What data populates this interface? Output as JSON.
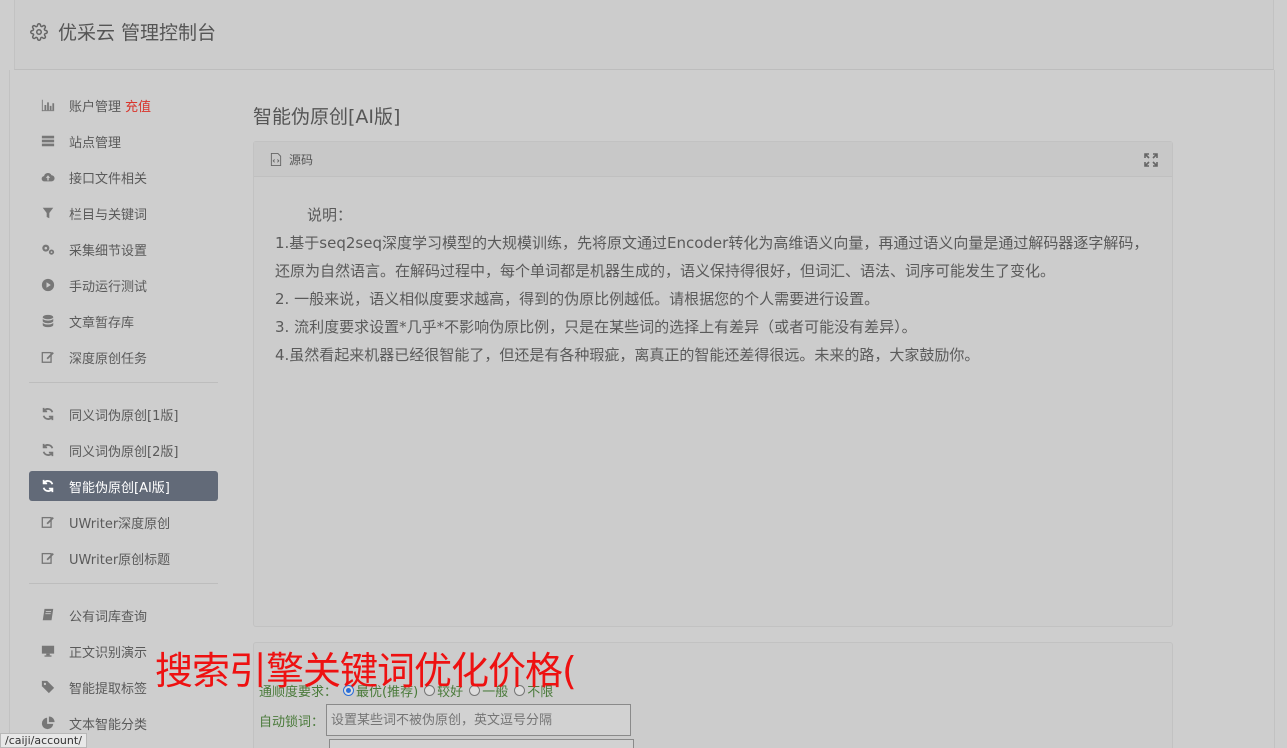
{
  "app": {
    "title": "优采云 管理控制台"
  },
  "sidebar": {
    "group1": [
      {
        "label": "账户管理",
        "badge": "充值",
        "icon": "bar-chart-icon"
      },
      {
        "label": "站点管理",
        "icon": "server-icon"
      },
      {
        "label": "接口文件相关",
        "icon": "cloud-upload-icon"
      },
      {
        "label": "栏目与关键词",
        "icon": "filter-icon"
      },
      {
        "label": "采集细节设置",
        "icon": "gears-icon"
      },
      {
        "label": "手动运行测试",
        "icon": "play-circle-icon"
      },
      {
        "label": "文章暂存库",
        "icon": "database-icon"
      },
      {
        "label": "深度原创任务",
        "icon": "edit-icon"
      }
    ],
    "group2": [
      {
        "label": "同义词伪原创[1版]",
        "icon": "refresh-icon"
      },
      {
        "label": "同义词伪原创[2版]",
        "icon": "refresh-icon"
      },
      {
        "label": "智能伪原创[AI版]",
        "icon": "refresh-icon",
        "active": true
      },
      {
        "label": "UWriter深度原创",
        "icon": "edit-icon"
      },
      {
        "label": "UWriter原创标题",
        "icon": "edit-icon"
      }
    ],
    "group3": [
      {
        "label": "公有词库查询",
        "icon": "book-icon"
      },
      {
        "label": "正文识别演示",
        "icon": "monitor-icon"
      },
      {
        "label": "智能提取标签",
        "icon": "tag-icon"
      },
      {
        "label": "文本智能分类",
        "icon": "pie-chart-icon"
      }
    ]
  },
  "main": {
    "title": "智能伪原创[AI版]",
    "panel": {
      "header": "源码",
      "intro": "说明：",
      "lines": [
        "1.基于seq2seq深度学习模型的大规模训练，先将原文通过Encoder转化为高维语义向量，再通过语义向量是通过解码器逐字解码，还原为自然语言。在解码过程中，每个单词都是机器生成的，语义保持得很好，但词汇、语法、词序可能发生了变化。",
        "2. 一般来说，语义相似度要求越高，得到的伪原比例越低。请根据您的个人需要进行设置。",
        "3. 流利度要求设置*几乎*不影响伪原比例，只是在某些词的选择上有差异（或者可能没有差异）。",
        "4.虽然看起来机器已经很智能了，但还是有各种瑕疵，离真正的智能还差得很远。未来的路，大家鼓励你。"
      ]
    },
    "form": {
      "fluency_label": "通顺度要求：",
      "fluency_options": [
        "最优(推荐)",
        "较好",
        "一般",
        "不限"
      ],
      "lock_label": "自动锁词：",
      "lock_placeholder": "设置某些词不被伪原创，英文逗号分隔"
    }
  },
  "overlay": {
    "text": "搜索引擎关键词优化价格("
  },
  "status_bar": {
    "url": "/caiji/account/"
  }
}
